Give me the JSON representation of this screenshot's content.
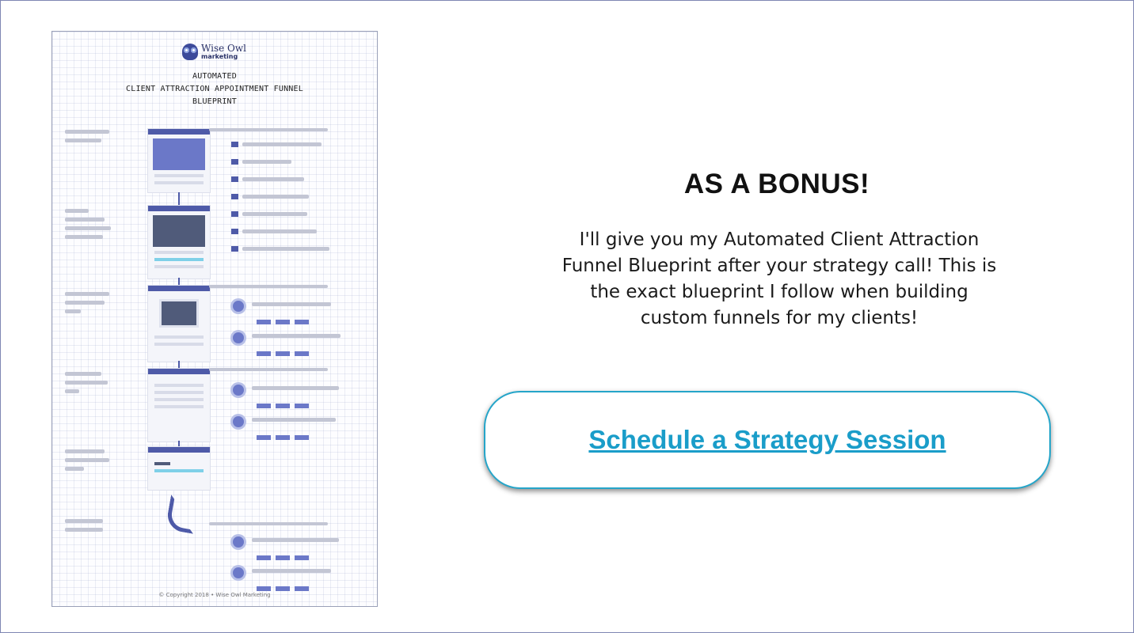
{
  "document": {
    "logo": {
      "name": "Wise Owl",
      "sub": "marketing"
    },
    "title_lines": [
      "AUTOMATED",
      "CLIENT ATTRACTION APPOINTMENT FUNNEL",
      "BLUEPRINT"
    ],
    "copyright": "© Copyright 2018 • Wise Owl Marketing"
  },
  "bonus": {
    "heading": "AS A BONUS!",
    "lines": [
      "I'll give you my Automated Client Attraction",
      "Funnel Blueprint after your strategy call! This is",
      "the exact blueprint I follow when building",
      "custom funnels for my clients!"
    ],
    "cta_label": "Schedule a Strategy Session"
  },
  "colors": {
    "accent": "#1a9dc9",
    "border": "#25a5c9",
    "doc_blue": "#4e5aa8"
  }
}
